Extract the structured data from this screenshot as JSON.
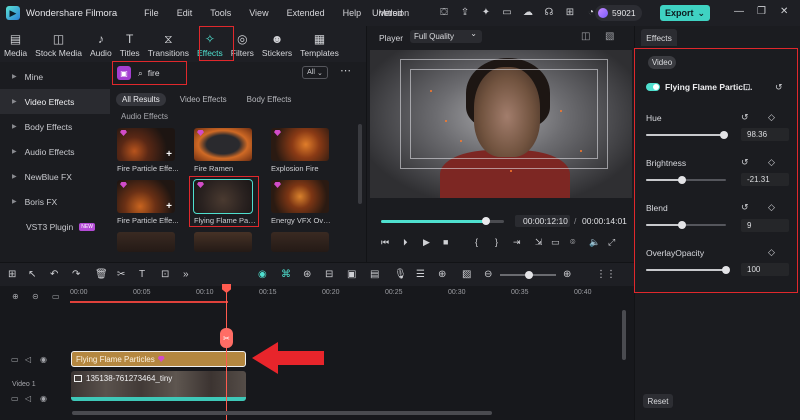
{
  "titlebar": {
    "app_name": "Wondershare Filmora",
    "menu": [
      "File",
      "Edit",
      "Tools",
      "View",
      "Extended",
      "Help",
      "Version"
    ],
    "document_title": "Untitled",
    "credits": "59021",
    "export_label": "Export"
  },
  "tabs": [
    {
      "label": "Media",
      "icon": "media-icon"
    },
    {
      "label": "Stock Media",
      "icon": "stock-media-icon"
    },
    {
      "label": "Audio",
      "icon": "audio-icon"
    },
    {
      "label": "Titles",
      "icon": "titles-icon"
    },
    {
      "label": "Transitions",
      "icon": "transitions-icon"
    },
    {
      "label": "Effects",
      "icon": "effects-icon",
      "active": true
    },
    {
      "label": "Filters",
      "icon": "filters-icon"
    },
    {
      "label": "Stickers",
      "icon": "stickers-icon"
    },
    {
      "label": "Templates",
      "icon": "templates-icon"
    }
  ],
  "sidebar": {
    "items": [
      {
        "label": "Mine"
      },
      {
        "label": "Video Effects",
        "active": true
      },
      {
        "label": "Body Effects"
      },
      {
        "label": "Audio Effects"
      },
      {
        "label": "NewBlue FX"
      },
      {
        "label": "Boris FX"
      },
      {
        "label": "VST3 Plugin",
        "badge": "NEW"
      }
    ]
  },
  "browser": {
    "search_value": "fire",
    "filter_label": "All",
    "filter_tabs": [
      "All Results",
      "Video Effects",
      "Body Effects"
    ],
    "section_label": "Audio Effects",
    "cards": [
      {
        "label": "Fire Particle Effe..."
      },
      {
        "label": "Fire Ramen"
      },
      {
        "label": "Explosion Fire"
      },
      {
        "label": "Fire Particle Effe..."
      },
      {
        "label": "Flying Flame Par..."
      },
      {
        "label": "Energy VFX Ove..."
      }
    ]
  },
  "player": {
    "label": "Player",
    "quality": "Full Quality",
    "current_time": "00:00:12:10",
    "separator": "/",
    "total_time": "00:00:14:01",
    "progress": 0.85
  },
  "right_panel": {
    "tab": "Effects",
    "section": "Video",
    "effect_name": "Flying Flame Particl...",
    "params": [
      {
        "label": "Hue",
        "value": "98.36",
        "level": 0.98
      },
      {
        "label": "Brightness",
        "value": "-21.31",
        "level": 0.45
      },
      {
        "label": "Blend",
        "value": "9",
        "level": 0.45
      },
      {
        "label": "OverlayOpacity",
        "value": "100",
        "level": 1.0
      }
    ],
    "reset_label": "Reset"
  },
  "timeline": {
    "ruler": [
      "00:00",
      "00:05",
      "00:10",
      "00:15",
      "00:20",
      "00:25",
      "00:30",
      "00:35",
      "00:40"
    ],
    "effect_clip": "Flying Flame Particles",
    "video_clip": "135138-761273464_tiny",
    "video_track_label": "Video 1"
  },
  "colors": {
    "accent": "#4fe0cf",
    "highlight": "#e0282c",
    "arrow": "#e8252b",
    "playhead": "#ff5b4f",
    "effect_clip": "#b48740"
  }
}
